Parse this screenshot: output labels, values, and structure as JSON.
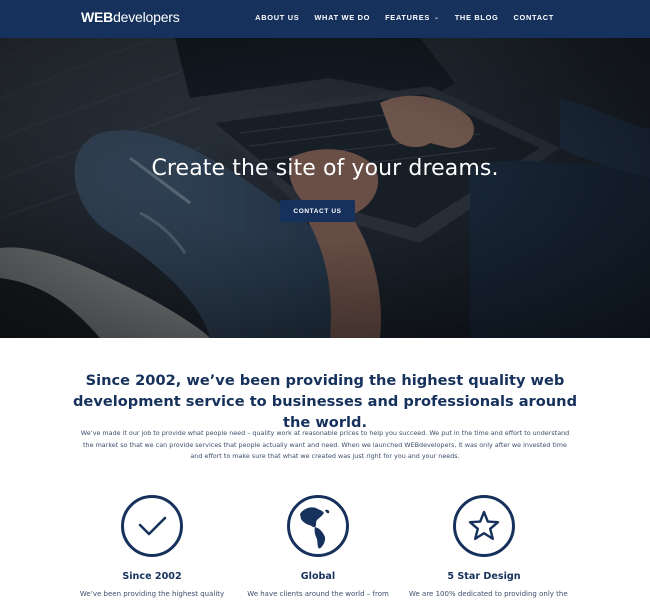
{
  "brand": {
    "bold": "WEB",
    "regular": "developers"
  },
  "nav": {
    "items": [
      {
        "label": "ABOUT US"
      },
      {
        "label": "WHAT WE DO"
      },
      {
        "label": "FEATURES"
      },
      {
        "label": "THE BLOG"
      },
      {
        "label": "CONTACT"
      }
    ]
  },
  "hero": {
    "title": "Create the site of your dreams.",
    "button_label": "CONTACT US"
  },
  "intro": {
    "heading": "Since 2002, we’ve been providing the highest quality web development service to businesses and professionals around the world.",
    "body": "We’ve made it our job to provide what people need – quality work at reasonable prices to help you succeed. We put in the time and effort to understand the market so that we can provide services that people actually want and need. When we launched WEBdevelopers, it was only after we invested time and effort to make sure that what we created was just right for you and your needs."
  },
  "features": [
    {
      "title": "Since 2002",
      "text": "We’ve been providing the highest quality",
      "icon": "checkmark-icon"
    },
    {
      "title": "Global",
      "text": "We have clients around the world – from",
      "icon": "globe-icon"
    },
    {
      "title": "5 Star Design",
      "text": "We are 100% dedicated to providing only the",
      "icon": "star-icon"
    }
  ],
  "colors": {
    "navy": "#16315c",
    "text": "#3d4f6d",
    "white": "#ffffff"
  }
}
